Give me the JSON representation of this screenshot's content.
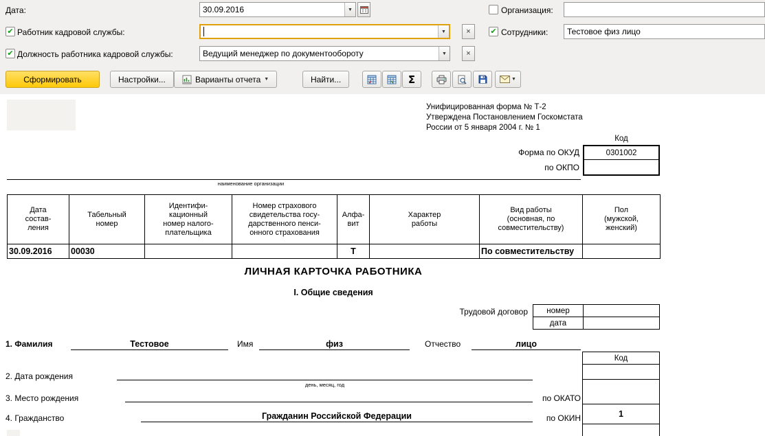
{
  "colors": {
    "generate_button": "#fdc908",
    "focus_border": "#dfa00a",
    "checkbox_check": "#12a012"
  },
  "filters": {
    "date_label": "Дата:",
    "date_value": "30.09.2016",
    "org": {
      "label": "Организация:",
      "value": "",
      "checked": false
    },
    "hr_worker": {
      "label": "Работник кадровой службы:",
      "value": "",
      "checked": true
    },
    "employees": {
      "label": "Сотрудники:",
      "value": "Тестовое физ лицо",
      "checked": true
    },
    "hr_position": {
      "label": "Должность работника кадровой службы:",
      "value": "Ведущий менеджер по документообороту",
      "checked": true
    }
  },
  "toolbar": {
    "generate": "Сформировать",
    "settings": "Настройки...",
    "variants": "Варианты отчета",
    "find": "Найти..."
  },
  "report": {
    "approval_lines": [
      "Унифицированная форма № Т-2",
      "Утверждена Постановлением Госкомстата",
      "России от 5 января 2004 г. № 1"
    ],
    "code_label": "Код",
    "okud_label": "Форма по ОКУД",
    "okud_value": "0301002",
    "okpo_label": "по ОКПО",
    "org_name_caption": "наименование организации",
    "table": {
      "headers": [
        "Дата\nсостав-\nления",
        "Табельный\nномер",
        "Идентифи-\nкационный\nномер налого-\nплательщика",
        "Номер страхового\nсвидетельства госу-\nдарственного пенси-\nонного страхования",
        "Алфа-\nвит",
        "Характер\nработы",
        "Вид работы\n(основная, по\nсовместительству)",
        "Пол\n(мужской,\nженский)"
      ],
      "row": [
        "30.09.2016",
        "00030",
        "",
        "",
        "Т",
        "",
        "По совместительству",
        ""
      ]
    },
    "title": "ЛИЧНАЯ КАРТОЧКА РАБОТНИКА",
    "section_title": "I. Общие сведения",
    "contract_label": "Трудовой договор",
    "contract_number_label": "номер",
    "contract_date_label": "дата",
    "fields": {
      "surname_label": "1. Фамилия",
      "surname_value": "Тестовое",
      "name_label": "Имя",
      "name_value": "физ",
      "patronymic_label": "Отчество",
      "patronymic_value": "лицо",
      "birth_label": "2. Дата рождения",
      "birth_hint": "день, месяц, год",
      "birthplace_label": "3. Место рождения",
      "okato_label": "по ОКАТО",
      "citizenship_label": "4. Гражданство",
      "citizenship_value": "Гражданин Российской Федерации",
      "okin_label": "по ОКИН",
      "okin_value": "1"
    }
  }
}
